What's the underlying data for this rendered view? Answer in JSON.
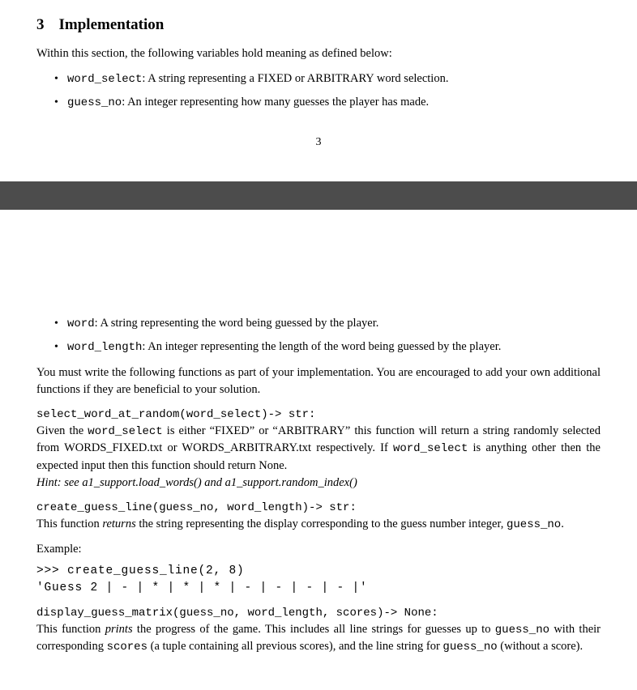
{
  "section": {
    "number": "3",
    "title": "Implementation"
  },
  "intro": "Within this section, the following variables hold meaning as defined below:",
  "vars1": [
    {
      "name": "word_select",
      "desc": ": A string representing a FIXED or ARBITRARY word selection."
    },
    {
      "name": "guess_no",
      "desc": ": An integer representing how many guesses the player has made."
    }
  ],
  "page_num": "3",
  "vars2": [
    {
      "name": "word",
      "desc": ": A string representing the word being guessed by the player."
    },
    {
      "name": "word_length",
      "desc": ": An integer representing the length of the word being guessed by the player."
    }
  ],
  "body_text": "You must write the following functions as part of your implementation. You are encouraged to add your own additional functions if they are beneficial to your solution.",
  "func1": {
    "sig": "select_word_at_random(word_select)-> str:",
    "desc_a": "Given the ",
    "desc_b": " is either “FIXED” or “ARBITRARY” this function will return a string randomly selected from WORDS_FIXED.txt or WORDS_ARBITRARY.txt respectively. If ",
    "desc_c": " is anything other then the expected input then this function should return None.",
    "var": "word_select",
    "hint": "Hint: see a1_support.load_words() and a1_support.random_index()"
  },
  "func2": {
    "sig": "create_guess_line(guess_no, word_length)-> str:",
    "desc_a": "This function ",
    "desc_em": "returns",
    "desc_b": " the string representing the display corresponding to the guess number integer, ",
    "var": "guess_no",
    "desc_c": "."
  },
  "example_label": "Example:",
  "example_code": ">>> create_guess_line(2, 8)\n'Guess 2 | - | * | * | * | - | - | - | - |'",
  "func3": {
    "sig": "display_guess_matrix(guess_no, word_length, scores)-> None:",
    "desc_a": "This function ",
    "desc_em": "prints",
    "desc_b": " the progress of the game. This includes all line strings for guesses up to ",
    "var1": "guess_no",
    "desc_c": " with their corresponding ",
    "var2": "scores",
    "desc_d": " (a tuple containing all previous scores), and the line string for ",
    "var3": "guess_no",
    "desc_e": " (without a score)."
  }
}
